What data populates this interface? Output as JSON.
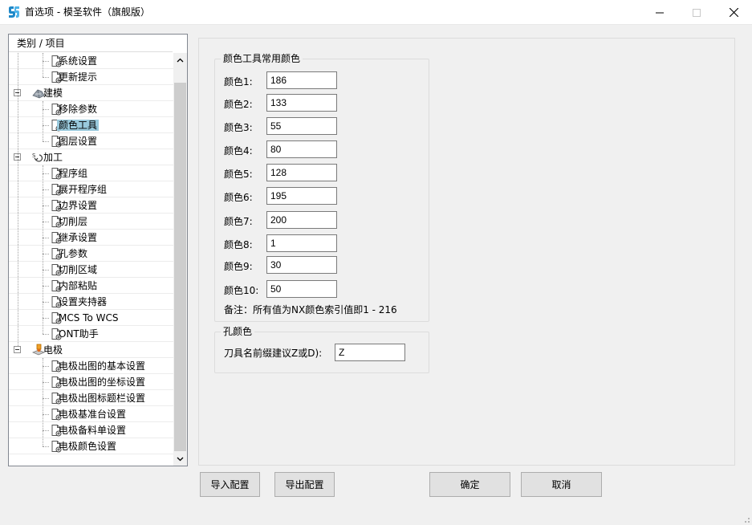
{
  "window": {
    "title": "首选项 - 模圣软件（旗舰版）"
  },
  "tree": {
    "header": "类别 / 项目",
    "rows": [
      {
        "label": "系统设置",
        "level": 1,
        "icon": "document-gear-icon"
      },
      {
        "label": "更新提示",
        "level": 1,
        "icon": "document-gear-icon"
      },
      {
        "label": "建模",
        "level": 0,
        "icon": "modeling-icon",
        "expanded": true
      },
      {
        "label": "移除参数",
        "level": 1,
        "icon": "document-gear-icon"
      },
      {
        "label": "颜色工具",
        "level": 1,
        "icon": "document-gear-icon",
        "selected": true
      },
      {
        "label": "图层设置",
        "level": 1,
        "icon": "document-gear-icon"
      },
      {
        "label": "加工",
        "level": 0,
        "icon": "machining-icon",
        "expanded": true
      },
      {
        "label": "程序组",
        "level": 1,
        "icon": "document-gear-icon"
      },
      {
        "label": "展开程序组",
        "level": 1,
        "icon": "document-gear-icon"
      },
      {
        "label": "边界设置",
        "level": 1,
        "icon": "document-gear-icon"
      },
      {
        "label": "切削层",
        "level": 1,
        "icon": "document-gear-icon"
      },
      {
        "label": "继承设置",
        "level": 1,
        "icon": "document-gear-icon"
      },
      {
        "label": "孔参数",
        "level": 1,
        "icon": "document-gear-icon"
      },
      {
        "label": "切削区域",
        "level": 1,
        "icon": "document-gear-icon"
      },
      {
        "label": "内部粘贴",
        "level": 1,
        "icon": "document-gear-icon"
      },
      {
        "label": "设置夹持器",
        "level": 1,
        "icon": "document-gear-icon"
      },
      {
        "label": "MCS To WCS",
        "level": 1,
        "icon": "document-gear-icon"
      },
      {
        "label": "ONT助手",
        "level": 1,
        "icon": "document-gear-icon"
      },
      {
        "label": "电极",
        "level": 0,
        "icon": "electrode-icon",
        "expanded": true
      },
      {
        "label": "电极出图的基本设置",
        "level": 1,
        "icon": "document-gear-icon"
      },
      {
        "label": "电极出图的坐标设置",
        "level": 1,
        "icon": "document-gear-icon"
      },
      {
        "label": "电极出图标题栏设置",
        "level": 1,
        "icon": "document-gear-icon"
      },
      {
        "label": "电极基准台设置",
        "level": 1,
        "icon": "document-gear-icon"
      },
      {
        "label": "电极备料单设置",
        "level": 1,
        "icon": "document-gear-icon"
      },
      {
        "label": "电极颜色设置",
        "level": 1,
        "icon": "document-gear-icon"
      }
    ]
  },
  "color_tool": {
    "group_title": "颜色工具常用颜色",
    "fields": [
      {
        "label": "颜色1:",
        "value": "186"
      },
      {
        "label": "颜色2:",
        "value": "133"
      },
      {
        "label": "颜色3:",
        "value": "55"
      },
      {
        "label": "颜色4:",
        "value": "80"
      },
      {
        "label": "颜色5:",
        "value": "128"
      },
      {
        "label": "颜色6:",
        "value": "195"
      },
      {
        "label": "颜色7:",
        "value": "200"
      },
      {
        "label": "颜色8:",
        "value": "1"
      },
      {
        "label": "颜色9:",
        "value": "30"
      },
      {
        "label": "颜色10:",
        "value": "50"
      }
    ],
    "note": "备注：所有值为NX颜色索引值即1 - 216"
  },
  "hole_color": {
    "group_title": "孔颜色",
    "prefix_label": "刀具名前缀建议Z或D):",
    "prefix_value": "Z"
  },
  "buttons": {
    "import": "导入配置",
    "export": "导出配置",
    "ok": "确定",
    "cancel": "取消"
  },
  "colors": {
    "selection": "#99c9dc",
    "logo": "#1e88c8"
  }
}
